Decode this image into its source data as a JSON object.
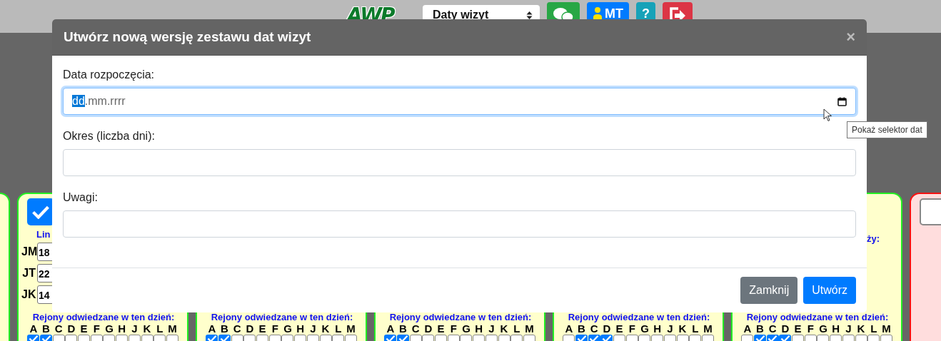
{
  "top_bar": {
    "logo": "AWP",
    "view_select": {
      "value": "Daty wizyt"
    },
    "buttons": [
      {
        "kind": "chat"
      },
      {
        "kind": "user",
        "label": "MT"
      },
      {
        "kind": "help",
        "label": "?"
      },
      {
        "kind": "logout"
      }
    ]
  },
  "cards": [
    {
      "kind": "stub"
    },
    {
      "kind": "day",
      "checked": true,
      "heading": "Lin",
      "limits": [
        {
          "label": "JM",
          "value": "18"
        },
        {
          "label": "JT",
          "value": "22"
        },
        {
          "label": "JK",
          "value": "14"
        }
      ],
      "regions_title": "Rejony odwiedzane w ten dzień:",
      "regions": [
        {
          "label": "A",
          "checked": true
        },
        {
          "label": "B",
          "checked": true
        },
        {
          "label": "C",
          "checked": false
        },
        {
          "label": "D",
          "checked": false
        },
        {
          "label": "E",
          "checked": false
        },
        {
          "label": "F",
          "checked": false
        },
        {
          "label": "G",
          "checked": false
        },
        {
          "label": "H",
          "checked": false
        },
        {
          "label": "J",
          "checked": false
        },
        {
          "label": "K",
          "checked": false
        },
        {
          "label": "L",
          "checked": false
        },
        {
          "label": "M",
          "checked": false
        }
      ]
    },
    {
      "kind": "day",
      "regions_title": "Rejony odwiedzane w ten dzień:",
      "regions": [
        {
          "label": "A",
          "checked": true
        },
        {
          "label": "B",
          "checked": true
        },
        {
          "label": "C",
          "checked": false
        },
        {
          "label": "D",
          "checked": false
        },
        {
          "label": "E",
          "checked": false
        },
        {
          "label": "F",
          "checked": false
        },
        {
          "label": "G",
          "checked": false
        },
        {
          "label": "H",
          "checked": false
        },
        {
          "label": "J",
          "checked": false
        },
        {
          "label": "K",
          "checked": false
        },
        {
          "label": "L",
          "checked": false
        },
        {
          "label": "M",
          "checked": false
        }
      ]
    },
    {
      "kind": "day",
      "regions_title": "Rejony odwiedzane w ten dzień:",
      "regions": [
        {
          "label": "A",
          "checked": true
        },
        {
          "label": "B",
          "checked": true
        },
        {
          "label": "C",
          "checked": false
        },
        {
          "label": "D",
          "checked": false
        },
        {
          "label": "E",
          "checked": false
        },
        {
          "label": "F",
          "checked": false
        },
        {
          "label": "G",
          "checked": false
        },
        {
          "label": "H",
          "checked": false
        },
        {
          "label": "J",
          "checked": false
        },
        {
          "label": "K",
          "checked": false
        },
        {
          "label": "L",
          "checked": false
        },
        {
          "label": "M",
          "checked": false
        }
      ]
    },
    {
      "kind": "day",
      "regions_title": "Rejony odwiedzane w ten dzień:",
      "regions": [
        {
          "label": "A",
          "checked": false
        },
        {
          "label": "B",
          "checked": true
        },
        {
          "label": "C",
          "checked": true
        },
        {
          "label": "D",
          "checked": true
        },
        {
          "label": "E",
          "checked": false
        },
        {
          "label": "F",
          "checked": false
        },
        {
          "label": "G",
          "checked": false
        },
        {
          "label": "H",
          "checked": false
        },
        {
          "label": "J",
          "checked": false
        },
        {
          "label": "K",
          "checked": false
        },
        {
          "label": "L",
          "checked": false
        },
        {
          "label": "M",
          "checked": false
        }
      ]
    },
    {
      "kind": "day",
      "side_note": "ży:",
      "regions_title": "Rejony odwiedzane w ten dzień:",
      "regions": [
        {
          "label": "A",
          "checked": false
        },
        {
          "label": "B",
          "checked": true
        },
        {
          "label": "C",
          "checked": true
        },
        {
          "label": "D",
          "checked": true
        },
        {
          "label": "E",
          "checked": false
        },
        {
          "label": "F",
          "checked": false
        },
        {
          "label": "G",
          "checked": false
        },
        {
          "label": "H",
          "checked": false
        },
        {
          "label": "J",
          "checked": false
        },
        {
          "label": "K",
          "checked": false
        },
        {
          "label": "L",
          "checked": false
        },
        {
          "label": "M",
          "checked": false
        }
      ]
    },
    {
      "kind": "off",
      "checked": false
    }
  ],
  "dialog": {
    "title": "Utwórz nową wersję zestawu dat wizyt",
    "close": "×",
    "fields": [
      {
        "kind": "date",
        "label": "Data rozpoczęcia:",
        "focused": true,
        "parts": [
          {
            "text": "dd",
            "selected": true
          },
          {
            "text": ".mm.rrrr",
            "selected": false
          }
        ],
        "tooltip": "Pokaż selektor dat"
      },
      {
        "kind": "text",
        "label": "Okres (liczba dni):",
        "focused": false
      },
      {
        "kind": "text",
        "label": "Uwagi:",
        "focused": false
      }
    ],
    "buttons": [
      {
        "label": "Zamknij",
        "kind": "secondary"
      },
      {
        "label": "Utwórz",
        "kind": "primary"
      }
    ]
  }
}
